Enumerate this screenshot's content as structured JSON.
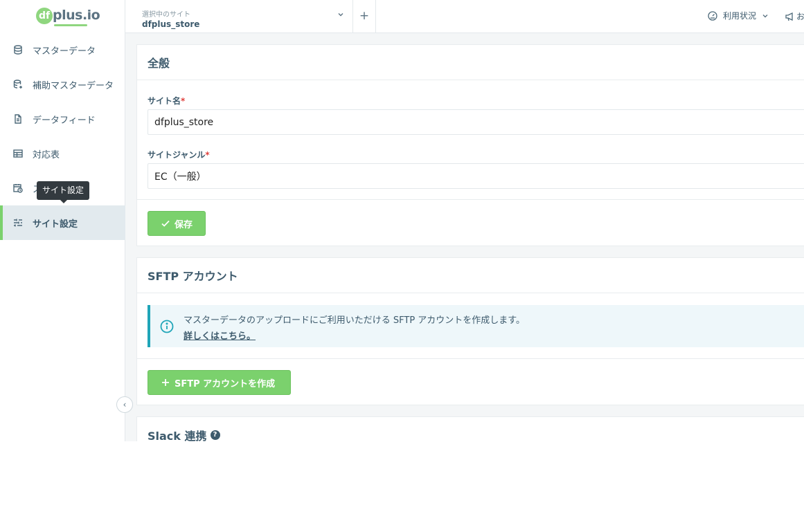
{
  "brand": {
    "logo_mark": "df",
    "logo_text": "plus.io"
  },
  "header": {
    "site_caption": "選択中のサイト",
    "site_value": "dfplus_store",
    "add_label": "+",
    "usage_label": "利用状況",
    "notify_label": "お"
  },
  "sidebar": {
    "items": [
      {
        "label": "マスターデータ",
        "icon": "database-icon"
      },
      {
        "label": "補助マスターデータ",
        "icon": "database-add-icon"
      },
      {
        "label": "データフィード",
        "icon": "file-icon"
      },
      {
        "label": "対応表",
        "icon": "table-icon"
      },
      {
        "label": "ス",
        "icon": "calendar-clock-icon"
      },
      {
        "label": "サイト設定",
        "icon": "sliders-icon",
        "active": true
      }
    ],
    "tooltip": "サイト設定",
    "collapse_glyph": "‹"
  },
  "general": {
    "title": "全般",
    "site_name_label": "サイト名",
    "site_name_value": "dfplus_store",
    "genre_label": "サイトジャンル",
    "genre_value": "EC（一般）",
    "required_mark": "*",
    "save_label": "保存"
  },
  "sftp": {
    "title": "SFTP アカウント",
    "info_text": "マスターデータのアップロードにご利用いただける SFTP アカウントを作成します。",
    "info_link": "詳しくはこちら。",
    "create_label": "SFTP アカウントを作成"
  },
  "slack": {
    "title": "Slack 連携",
    "help_glyph": "?"
  },
  "colors": {
    "accent": "#7bd16d",
    "text": "#3d5a6c",
    "info_border": "#1fa5b8",
    "required": "#e0413d"
  }
}
